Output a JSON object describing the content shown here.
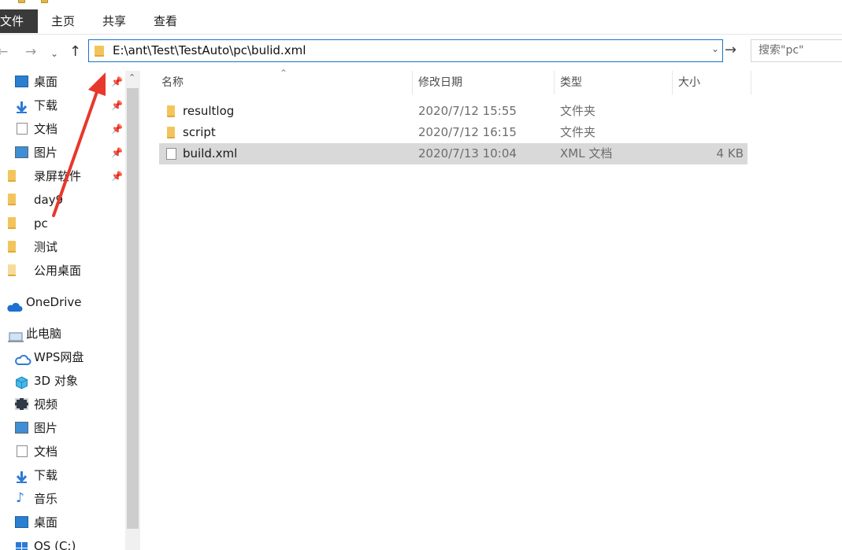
{
  "ribbon": {
    "tabs": [
      {
        "label": "文件"
      },
      {
        "label": "主页"
      },
      {
        "label": "共享"
      },
      {
        "label": "查看"
      }
    ]
  },
  "address": {
    "path": "E:\\ant\\Test\\TestAuto\\pc\\bulid.xml"
  },
  "search": {
    "placeholder": "搜索\"pc\""
  },
  "nav": {
    "quick": [
      {
        "label": "桌面",
        "icon": "desktop-icon"
      },
      {
        "label": "下载",
        "icon": "download-icon"
      },
      {
        "label": "文档",
        "icon": "document-icon"
      },
      {
        "label": "图片",
        "icon": "picture-icon"
      },
      {
        "label": "录屏软件",
        "icon": "folder-icon"
      },
      {
        "label": "day9",
        "icon": "folder-icon"
      },
      {
        "label": "pc",
        "icon": "folder-icon"
      },
      {
        "label": "测试",
        "icon": "folder-icon"
      },
      {
        "label": "公用桌面",
        "icon": "folder-icon"
      }
    ],
    "onedrive": "OneDrive",
    "thispc": "此电脑",
    "pc_items": [
      {
        "label": "WPS网盘",
        "icon": "cloud-icon"
      },
      {
        "label": "3D 对象",
        "icon": "cube-icon"
      },
      {
        "label": "视频",
        "icon": "video-icon"
      },
      {
        "label": "图片",
        "icon": "picture-icon"
      },
      {
        "label": "文档",
        "icon": "document-icon"
      },
      {
        "label": "下载",
        "icon": "download-icon"
      },
      {
        "label": "音乐",
        "icon": "music-icon"
      },
      {
        "label": "桌面",
        "icon": "desktop-icon"
      },
      {
        "label": "OS (C:)",
        "icon": "drive-icon"
      }
    ]
  },
  "columns": {
    "name": "名称",
    "date": "修改日期",
    "type": "类型",
    "size": "大小"
  },
  "files": [
    {
      "name": "resultlog",
      "date": "2020/7/12 15:55",
      "type": "文件夹",
      "size": "",
      "icon": "folder-icon"
    },
    {
      "name": "script",
      "date": "2020/7/12 16:15",
      "type": "文件夹",
      "size": "",
      "icon": "folder-icon"
    },
    {
      "name": "build.xml",
      "date": "2020/7/13 10:04",
      "type": "XML 文档",
      "size": "4 KB",
      "icon": "file-icon"
    }
  ],
  "colors": {
    "address_border": "#1a72c8",
    "selected_row": "#d9d9d9",
    "folder": "#f2c55c",
    "annotation_arrow": "#e8372c"
  }
}
